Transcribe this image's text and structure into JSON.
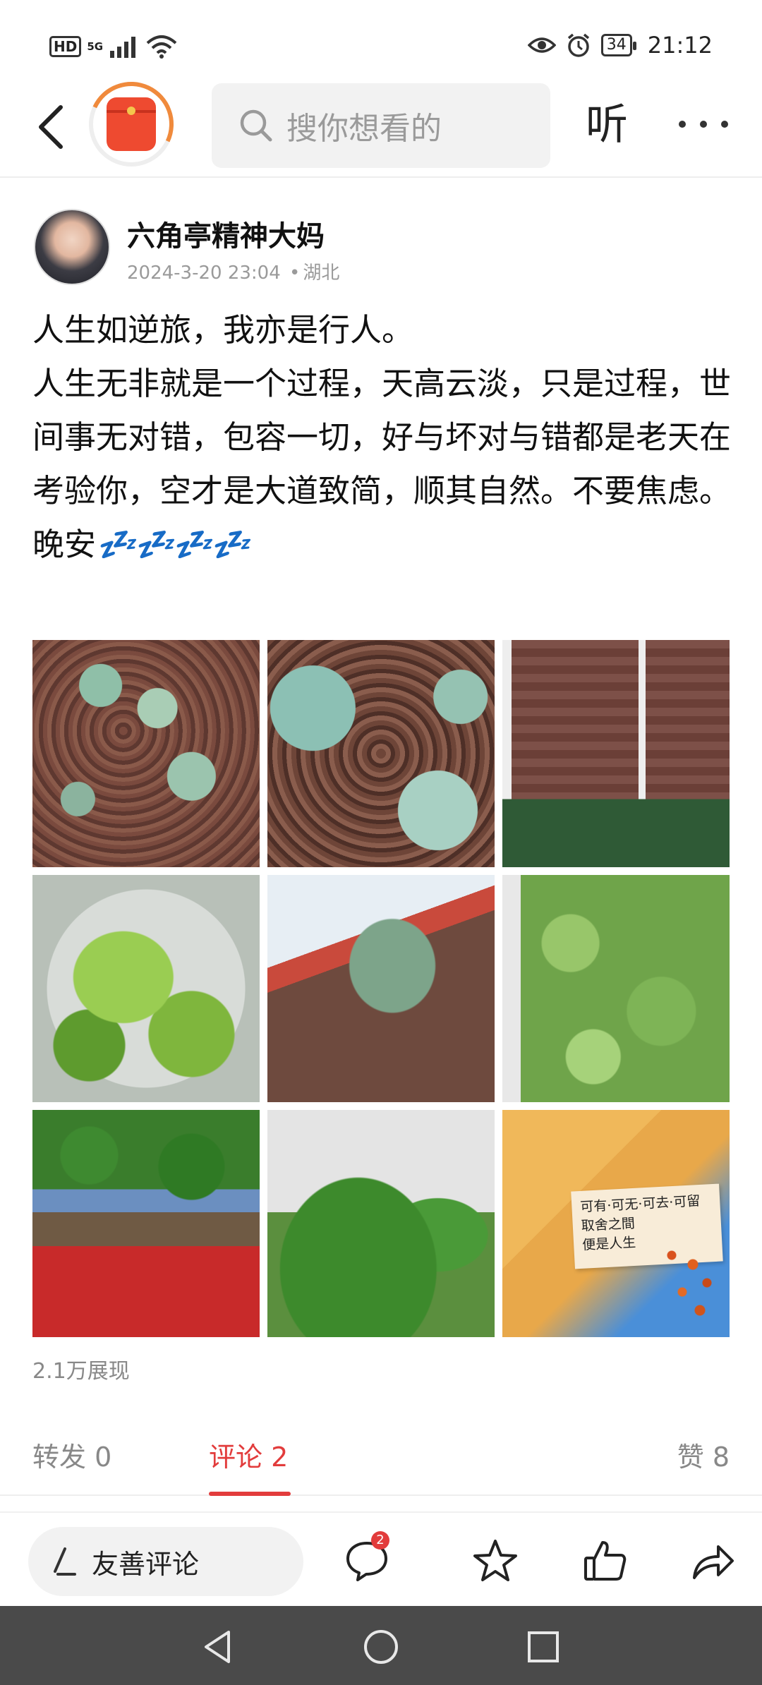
{
  "status_bar": {
    "hd": "HD",
    "network": "5G",
    "battery": "34",
    "time": "21:12"
  },
  "nav": {
    "search_placeholder": "搜你想看的",
    "listen_label": "听"
  },
  "post": {
    "author": "六角亭精神大妈",
    "timestamp": "2024-3-20 23:04",
    "location": "湖北",
    "separator": "•",
    "lines": [
      "人生如逆旅，我亦是行人。",
      "人生无非就是一个过程，天高云淡，只是过程，世间事无对错，包容一切，好与坏对与错都是老天在考验你，空才是大道致简，顺其自然。不要焦虑。"
    ],
    "goodnight": "晚安",
    "goodnight_emoji": "💤💤💤💤",
    "photo_quote": [
      "可有·可无·可去·可留",
      "取舍之間",
      "便是人生"
    ],
    "views": "2.1万展现"
  },
  "tabs": {
    "forward_label": "转发",
    "forward_count": "0",
    "comment_label": "评论",
    "comment_count": "2",
    "like_label": "赞",
    "like_count": "8"
  },
  "bottom_bar": {
    "comment_placeholder": "友善评论",
    "comments_badge": "2"
  },
  "colors": {
    "accent_red": "#e23c3c",
    "system_nav": "#4a4a4a"
  }
}
